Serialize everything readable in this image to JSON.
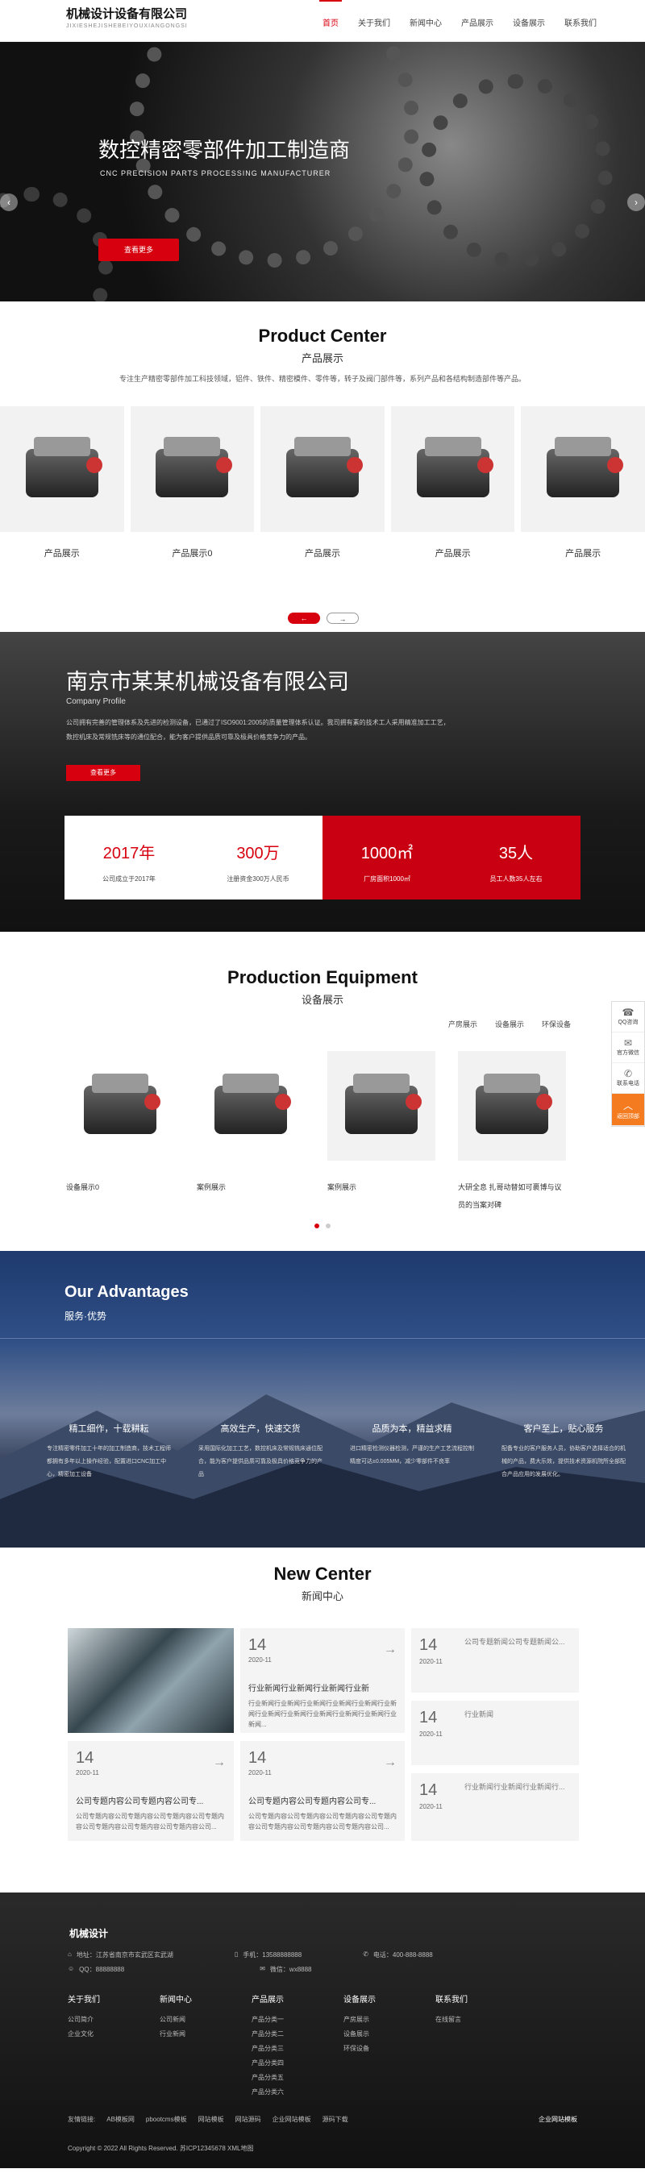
{
  "header": {
    "logo_title": "机械设计设备有限公司",
    "logo_sub": "JIXIESHEJISHEBEIYOUXIANGONGSI",
    "nav": [
      "首页",
      "关于我们",
      "新闻中心",
      "产品展示",
      "设备展示",
      "联系我们"
    ]
  },
  "hero": {
    "title": "数控精密零部件加工制造商",
    "subtitle": "CNC PRECISION PARTS PROCESSING MANUFACTURER",
    "button": "查看更多",
    "prev": "‹",
    "next": "›"
  },
  "products": {
    "title_en": "Product Center",
    "title_cn": "产品展示",
    "desc": "专注生产精密零部件加工科技领域，铝件、铁件、精密模件、零件等，转子及阀门部件等，系列产品和各结构制造部件等产品。",
    "items": [
      "产品展示",
      "产品展示0",
      "产品展示",
      "产品展示",
      "产品展示"
    ],
    "pager_prev": "←",
    "pager_next": "→"
  },
  "company": {
    "title": "南京市某某机械设备有限公司",
    "profile": "Company Profile",
    "desc": "公司拥有完善的管理体系及先进的检测设备，已通过了ISO9001:2005的质量管理体系认证。我司拥有素的技术工人采用精准加工工艺，数控机床及常规铣床等的通位配合，能为客户提供品质可靠及极具价格竞争力的产品。",
    "button": "查看更多",
    "stats": [
      {
        "value": "2017年",
        "label": "公司成立于2017年"
      },
      {
        "value": "300万",
        "label": "注册资金300万人民币"
      },
      {
        "value": "1000㎡",
        "label": "厂房面积1000㎡"
      },
      {
        "value": "35人",
        "label": "员工人数35人左右"
      }
    ]
  },
  "equipment": {
    "title_en": "Production Equipment",
    "title_cn": "设备展示",
    "tabs": [
      "产房展示",
      "设备展示",
      "环保设备"
    ],
    "items": [
      "设备展示0",
      "案例展示",
      "案例展示",
      "大研全息 扎哥动替如可裹博与议员的当案对碑"
    ]
  },
  "advantages": {
    "title_en": "Our Advantages",
    "title_cn": "服务·优势",
    "items": [
      {
        "h": "精工细作，十载耕耘",
        "d": "专注精密零件加工十年的加工制造商，技术工程师都拥有多年以上操作经验，配置进口CNC加工中心，精密加工设备"
      },
      {
        "h": "高效生产，快速交货",
        "d": "采用国际化加工工艺，数控机床及常规铣床通位配合，能为客户提供品质可靠及极具价格竞争力的产品"
      },
      {
        "h": "品质为本，精益求精",
        "d": "进口精密检测仪器检测，严谨的生产工艺流程控制精度可达±0.005MM，减少零部件不良率"
      },
      {
        "h": "客户至上，贴心服务",
        "d": "配备专业的客户服务人员，协助客户选择适合的机械的产品，费大乐效，提供技术资源机院所全部配合产品应用的发展优化。"
      }
    ]
  },
  "news": {
    "title_en": "New Center",
    "title_cn": "新闻中心",
    "cards": [
      {
        "day": "14",
        "ym": "2020-11",
        "h": "行业新闻行业新闻行业新闻行业新",
        "d": "行业新闻行业新闻行业新闻行业新闻行业新闻行业新闻行业新闻行业新闻行业新闻行业新闻行业新闻行业新闻..."
      },
      {
        "day": "14",
        "ym": "2020-11",
        "h": "公司专题内容公司专题内容公司专...",
        "d": "公司专题内容公司专题内容公司专题内容公司专题内容公司专题内容公司专题内容公司专题内容公司..."
      },
      {
        "day": "14",
        "ym": "2020-11",
        "h": "公司专题内容公司专题内容公司专...",
        "d": "公司专题内容公司专题内容公司专题内容公司专题内容公司专题内容公司专题内容公司专题内容公司..."
      }
    ],
    "side": [
      {
        "day": "14",
        "ym": "2020-11",
        "h": "公司专题新闻公司专题新闻公..."
      },
      {
        "day": "14",
        "ym": "2020-11",
        "h": "行业新闻"
      },
      {
        "day": "14",
        "ym": "2020-11",
        "h": "行业新闻行业新闻行业新闻行..."
      }
    ]
  },
  "footer": {
    "title": "机械设计",
    "address": "地址：江苏省南京市玄武区玄武湖",
    "mobile": "手机：13588888888",
    "phone": "电话：400-888-8888",
    "qq": "QQ：88888888",
    "wechat": "微信：wx8888",
    "cols": [
      {
        "h": "关于我们",
        "items": [
          "公司简介",
          "企业文化"
        ]
      },
      {
        "h": "新闻中心",
        "items": [
          "公司新闻",
          "行业新闻"
        ]
      },
      {
        "h": "产品展示",
        "items": [
          "产品分类一",
          "产品分类二",
          "产品分类三",
          "产品分类四",
          "产品分类五",
          "产品分类六"
        ]
      },
      {
        "h": "设备展示",
        "items": [
          "产房展示",
          "设备展示",
          "环保设备"
        ]
      },
      {
        "h": "联系我们",
        "items": [
          "在线留言"
        ]
      }
    ],
    "links": [
      "友情链接:",
      "AB模板网",
      "pbootcms模板",
      "网站模板",
      "网站源码",
      "企业网站模板",
      "源码下载"
    ],
    "right": "企业网站模板",
    "copyright": "Copyright © 2022 All Rights Reserved.  苏ICP12345678  XML地图"
  },
  "side": {
    "items": [
      {
        "icon": "☎",
        "label": "QQ咨询"
      },
      {
        "icon": "✉",
        "label": "官方微信"
      },
      {
        "icon": "✆",
        "label": "联系电话"
      },
      {
        "icon": "︿",
        "label": "返回顶部"
      }
    ]
  }
}
